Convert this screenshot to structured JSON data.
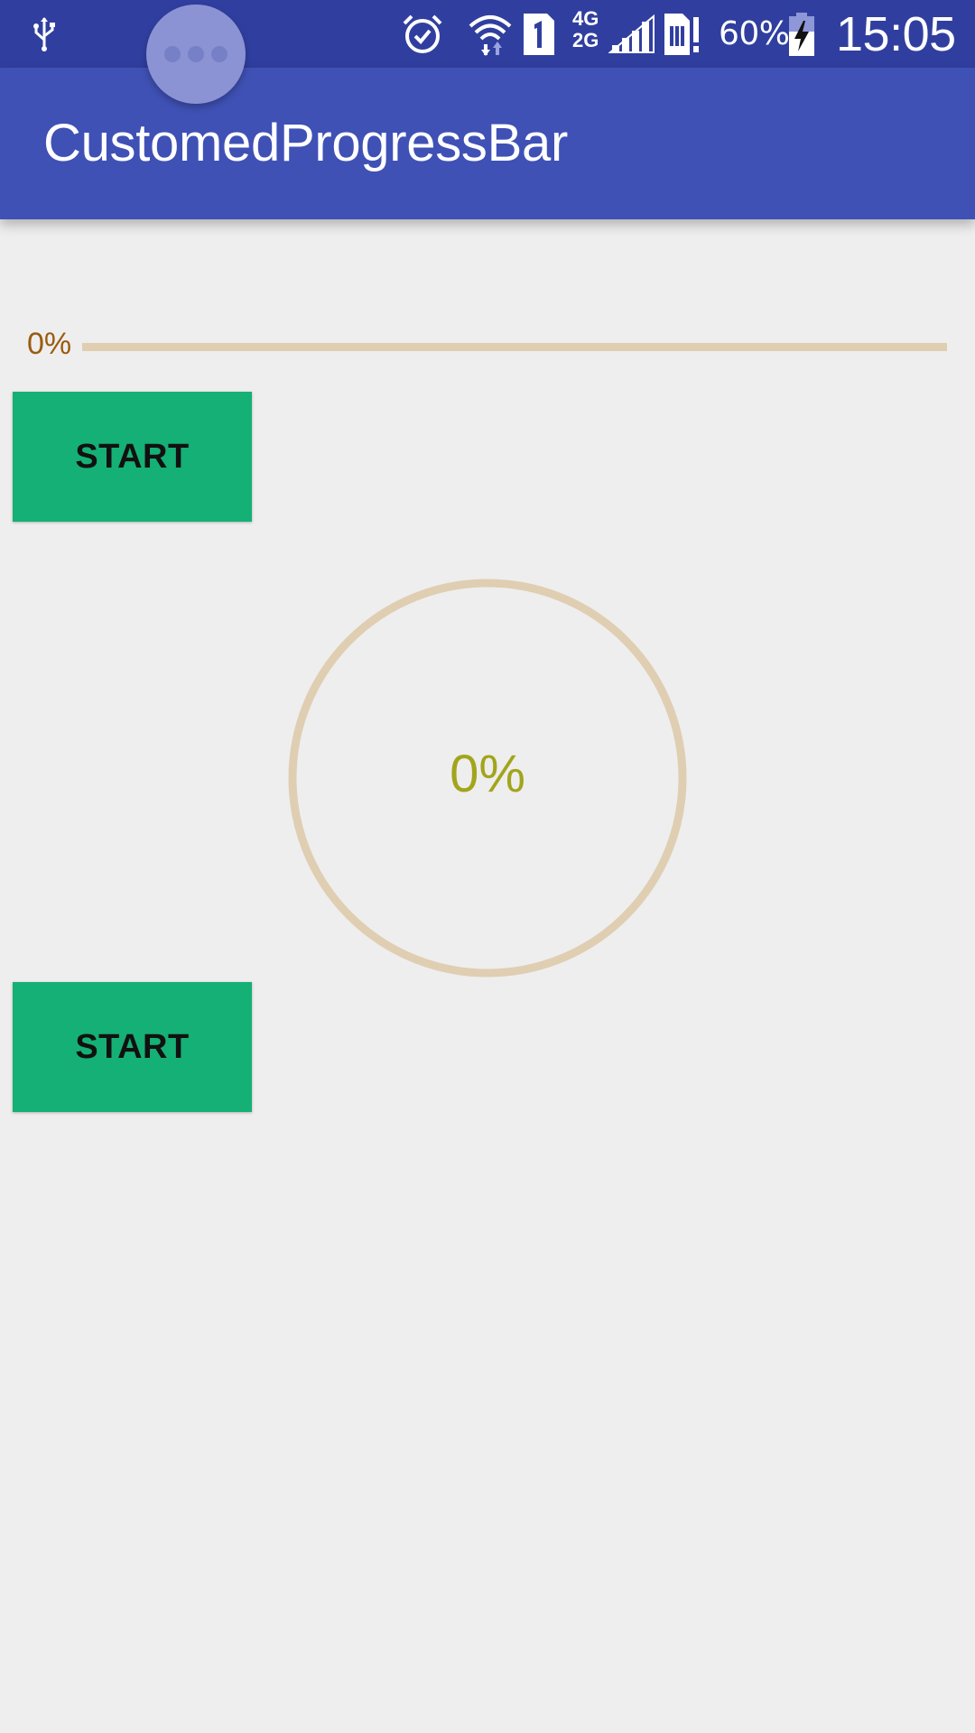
{
  "status_bar": {
    "network_top": "4G",
    "network_bottom": "2G",
    "battery": "60%",
    "time": "15:05",
    "icons": [
      "usb-icon",
      "alarm-icon",
      "wifi-icon",
      "sim1-icon",
      "signal-icon",
      "sim-alert-icon",
      "battery-charging-icon"
    ]
  },
  "app_bar": {
    "title": "CustomedProgressBar",
    "color": "#3f51b5"
  },
  "linear_progress": {
    "label": "0%",
    "value": 0,
    "track_color": "#e0ceb2",
    "label_color": "#9a5c10"
  },
  "circular_progress": {
    "label": "0%",
    "value": 0,
    "ring_color": "#e0ceb2",
    "label_color": "#a2a51c"
  },
  "buttons": {
    "start_1": "START",
    "start_2": "START",
    "color": "#15b075"
  }
}
